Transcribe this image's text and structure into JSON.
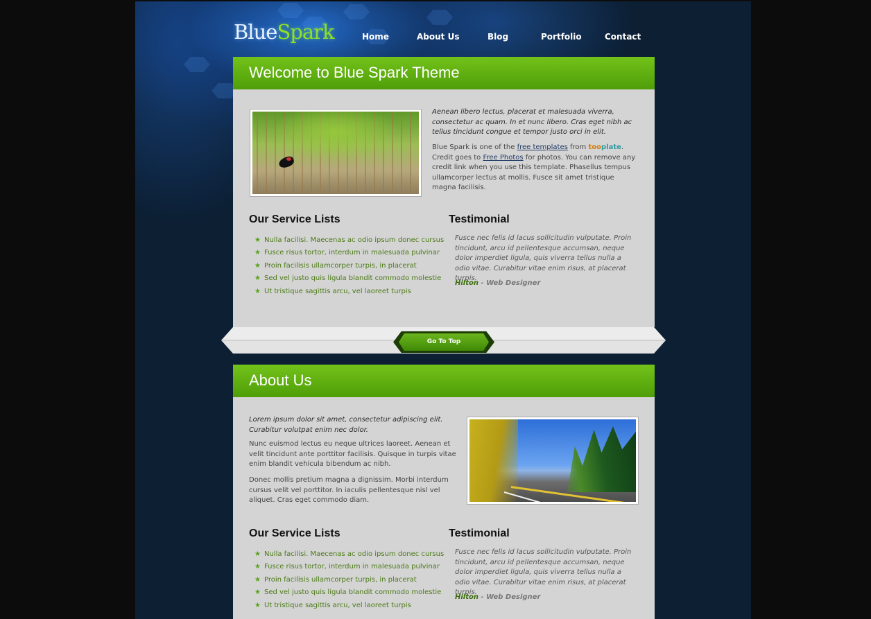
{
  "logo": {
    "part1": "Blue",
    "part2": "Spark"
  },
  "nav": [
    "Home",
    "About Us",
    "Blog",
    "Portfolio",
    "Contact"
  ],
  "welcome": {
    "title": "Welcome to Blue Spark Theme",
    "intro_em": "Aenean libero lectus, placerat et malesuada viverra, consectetur ac quam. In et nunc libero. Cras eget nibh ac tellus tincidunt congue et tempor justo orci in elit.",
    "intro": {
      "t1": "Blue Spark is one of the ",
      "link1": "free templates",
      "t2": " from ",
      "brand_a": "too",
      "brand_b": "plate",
      "t3": ". Credit goes to ",
      "link2": "Free Photos",
      "t4": " for photos. You can remove any credit link when you use this template. Phasellus tempus ullamcorper lectus at mollis. Fusce sit amet tristique magna facilisis."
    },
    "services_title": "Our Service Lists",
    "services": [
      "Nulla facilisi. Maecenas ac odio ipsum donec cursus",
      "Fusce risus tortor, interdum in malesuada pulvinar",
      "Proin facilisis ullamcorper turpis, in placerat",
      "Sed vel justo quis ligula blandit commodo molestie",
      "Ut tristique sagittis arcu, vel laoreet turpis"
    ],
    "testimonial_title": "Testimonial",
    "testimonial": "Fusce nec felis id lacus sollicitudin vulputate. Proin tincidunt, arcu id pellentesque accumsan, neque dolor imperdiet ligula, quis viverra tellus nulla a odio vitae. Curabitur vitae enim risus, at placerat turpis.",
    "author_name": "Hilton",
    "author_role": " - Web Designer"
  },
  "gotop": "Go To Top",
  "about": {
    "title": "About Us",
    "intro_em": "Lorem ipsum dolor sit amet, consectetur adipiscing elit. Curabitur volutpat enim nec dolor.",
    "p1": "Nunc euismod lectus eu neque ultrices laoreet. Aenean et velit tincidunt ante porttitor facilisis. Quisque in turpis vitae enim blandit vehicula bibendum ac nibh.",
    "p2": "Donec mollis pretium magna a dignissim. Morbi interdum cursus velit vel porttitor. In iaculis pellentesque nisl vel aliquet. Cras eget commodo diam.",
    "services_title": "Our Service Lists",
    "services": [
      "Nulla facilisi. Maecenas ac odio ipsum donec cursus",
      "Fusce risus tortor, interdum in malesuada pulvinar",
      "Proin facilisis ullamcorper turpis, in placerat",
      "Sed vel justo quis ligula blandit commodo molestie",
      "Ut tristique sagittis arcu, vel laoreet turpis"
    ],
    "testimonial_title": "Testimonial",
    "testimonial": "Fusce nec felis id lacus sollicitudin vulputate. Proin tincidunt, arcu id pellentesque accumsan, neque dolor imperdiet ligula, quis viverra tellus nulla a odio vitae. Curabitur vitae enim risus, at placerat turpis.",
    "author_name": "Hilton",
    "author_role": " - Web Designer"
  },
  "colors": {
    "accent_green": "#5aab10",
    "page_bg": "#0c1f33",
    "panel_bg": "#d4d4d4",
    "list_text": "#4b7a16"
  },
  "icons": {
    "list_bullet": "star-icon",
    "photo_1": "bird-photo",
    "photo_2": "road-photo"
  }
}
